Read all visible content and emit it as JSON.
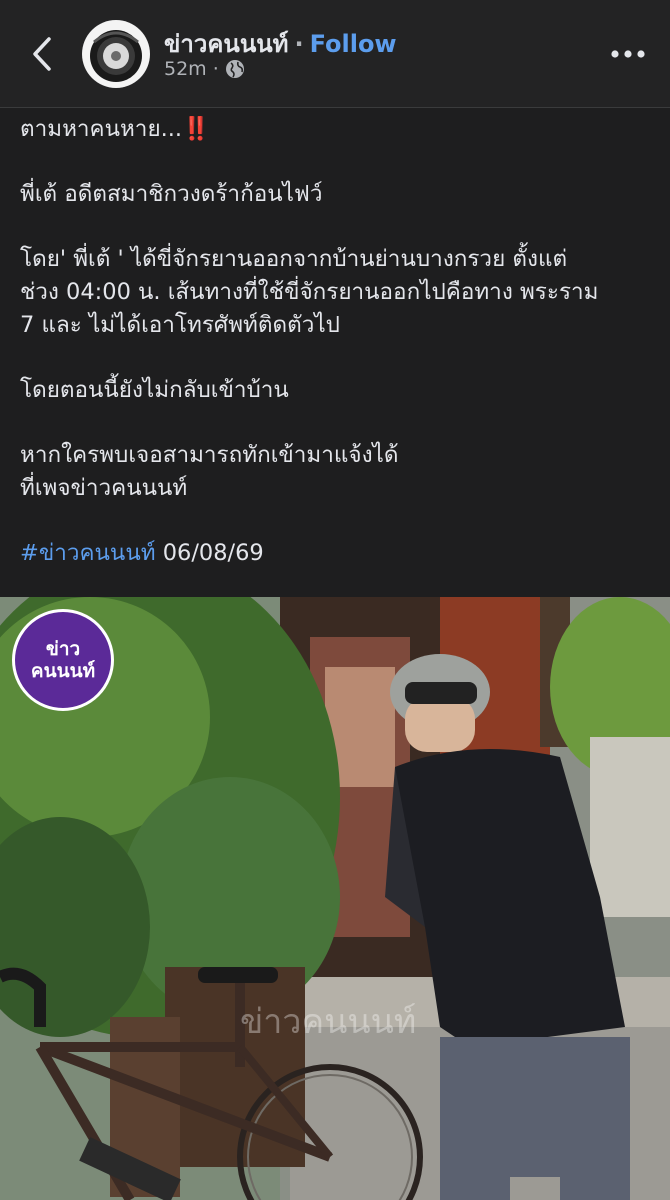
{
  "header": {
    "page_name": "ข่าวคนนนท์",
    "separator": "·",
    "follow_label": "Follow",
    "timestamp": "52m",
    "meta_separator": "·",
    "back_icon": "chevron-left-icon",
    "audience_icon": "globe-icon",
    "more_icon": "more-horizontal-icon"
  },
  "post": {
    "line1": "ตามหาคนหาย...",
    "line1_emoji": "‼️",
    "line2": "พี่เต้ อดีตสมาชิกวงดร้าก้อนไฟว์",
    "line3a": "โดย' พี่เต้ ' ได้ขี่จักรยานออกจากบ้านย่านบางกรวย ตั้งแต่",
    "line3b": "ช่วง 04:00 น. เส้นทางที่ใช้ขี่จักรยานออกไปคือทาง พระราม",
    "line3c": "7 และ ไม่ได้เอาโทรศัพท์ติดตัวไป",
    "line4": "โดยตอนนี้ยังไม่กลับเข้าบ้าน",
    "line5a": "หากใครพบเจอสามารถทักเข้ามาแจ้งได้",
    "line5b": "ที่เพจข่าวคนนนท์",
    "hashtag": "#ข่าวคนนนท์",
    "date": "06/08/69"
  },
  "photo": {
    "badge_line1": "ข่าว",
    "badge_line2": "คนนนท์",
    "watermark": "ข่าวคนนนท์"
  },
  "colors": {
    "background": "#1e1e1f",
    "link": "#5c9ded",
    "badge": "#5b2a98"
  }
}
